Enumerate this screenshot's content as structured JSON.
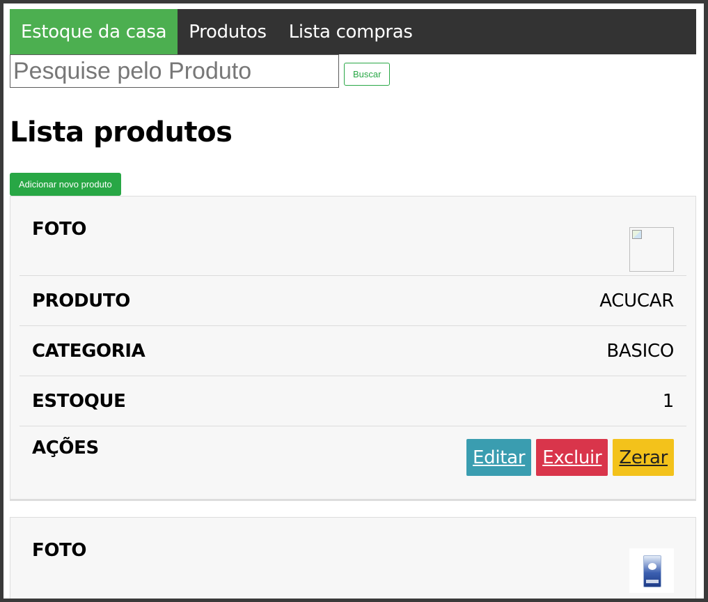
{
  "nav": {
    "items": [
      {
        "label": "Estoque da casa",
        "active": true
      },
      {
        "label": "Produtos",
        "active": false
      },
      {
        "label": "Lista compras",
        "active": false
      }
    ],
    "active_color": "#4caf50",
    "bar_color": "#333333"
  },
  "search": {
    "placeholder": "Pesquise pelo Produto",
    "value": "",
    "button_label": "Buscar"
  },
  "page_title": "Lista produtos",
  "add_button_label": "Adicionar novo produto",
  "products": [
    {
      "photo_label": "FOTO",
      "photo": "broken-image-icon",
      "product_label": "PRODUTO",
      "product_value": "ACUCAR",
      "category_label": "CATEGORIA",
      "category_value": "BASICO",
      "stock_label": "ESTOQUE",
      "stock_value": "1",
      "actions_label": "AÇÕES",
      "actions": {
        "edit": "Editar",
        "delete": "Excluir",
        "reset": "Zerar"
      }
    },
    {
      "photo_label": "FOTO",
      "photo": "sugar-bag-image"
    }
  ],
  "colors": {
    "edit": "#3a9db0",
    "delete": "#d9354b",
    "reset": "#f3c21b",
    "add": "#28a745"
  }
}
